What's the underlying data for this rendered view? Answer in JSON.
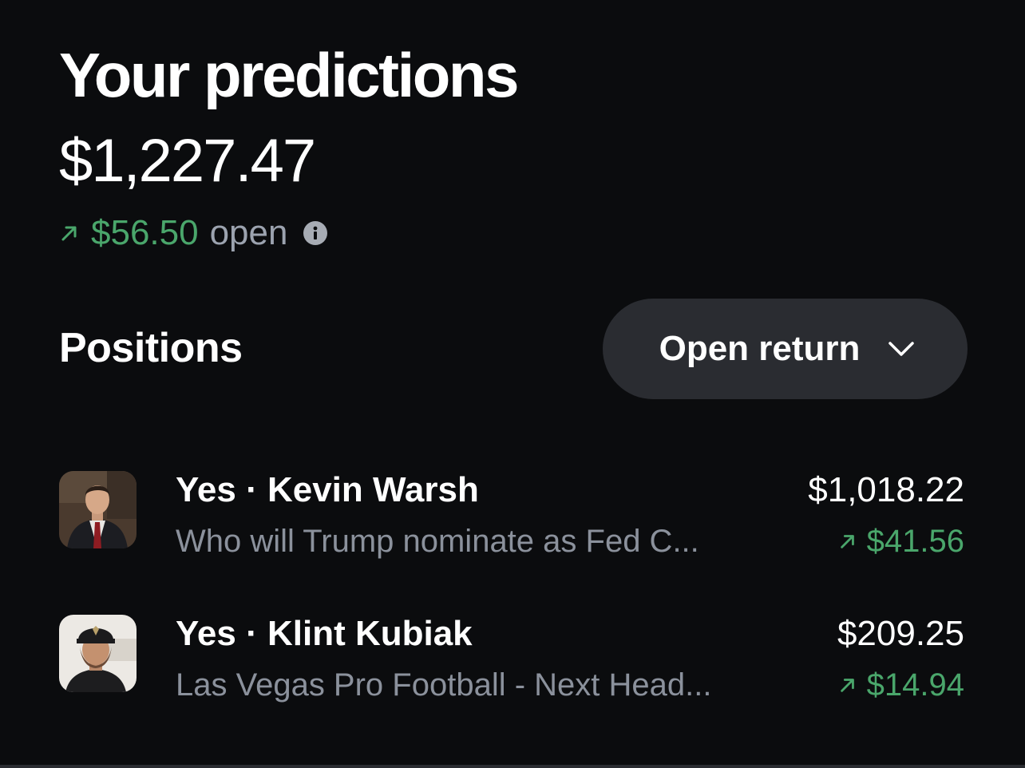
{
  "header": {
    "title": "Your predictions",
    "total_value": "$1,227.47",
    "open_change": "$56.50",
    "open_label": "open"
  },
  "positions": {
    "title": "Positions",
    "sort_label": "Open return",
    "items": [
      {
        "outcome_title": "Yes · Kevin Warsh",
        "market": "Who will Trump nominate as Fed C...",
        "value": "$1,018.22",
        "change": "$41.56"
      },
      {
        "outcome_title": "Yes · Klint Kubiak",
        "market": "Las Vegas Pro Football - Next Head...",
        "value": "$209.25",
        "change": "$14.94"
      }
    ]
  },
  "colors": {
    "background": "#0b0c0e",
    "positive": "#4aa66b",
    "muted": "#8b919c",
    "pill": "#2a2c31"
  },
  "icons": [
    "arrow-up-right-icon",
    "info-icon",
    "chevron-down-icon"
  ]
}
